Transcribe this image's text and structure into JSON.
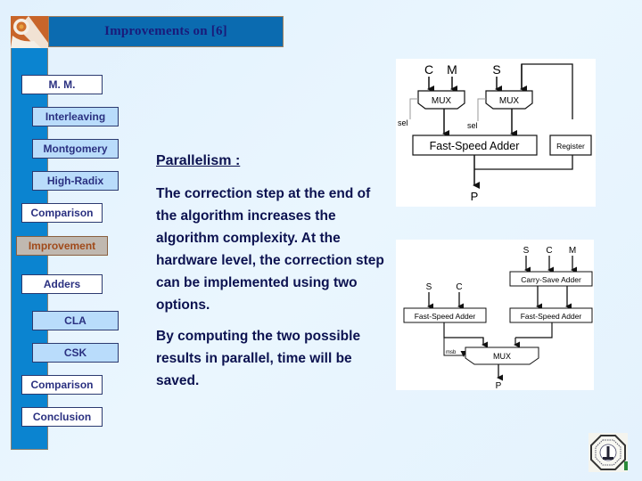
{
  "header": {
    "title": "Improvements on [6]"
  },
  "sidebar": {
    "items": [
      {
        "label": "M. M.",
        "level": "main",
        "active": false
      },
      {
        "label": "Interleaving",
        "level": "sub",
        "active": false
      },
      {
        "label": "Montgomery",
        "level": "sub",
        "active": false
      },
      {
        "label": "High-Radix",
        "level": "sub",
        "active": false
      },
      {
        "label": "Comparison",
        "level": "main",
        "active": false
      },
      {
        "label": "Improvement",
        "level": "main",
        "active": true
      },
      {
        "label": "Adders",
        "level": "main",
        "active": false
      },
      {
        "label": "CLA",
        "level": "sub",
        "active": false
      },
      {
        "label": "CSK",
        "level": "sub",
        "active": false
      },
      {
        "label": "Comparison",
        "level": "main",
        "active": false
      },
      {
        "label": "Conclusion",
        "level": "main",
        "active": false
      }
    ]
  },
  "content": {
    "heading": "Parallelism :",
    "paragraph1": "The correction step at the end of the algorithm increases the algorithm complexity. At the hardware level, the correction step can be implemented using two options.",
    "paragraph2": "By computing the two possible results in parallel, time will be saved."
  },
  "diagram1": {
    "inputs": [
      "C",
      "M",
      "S"
    ],
    "mux1": "MUX",
    "mux2": "MUX",
    "sel1": "sel",
    "sel2": "sel",
    "adder": "Fast-Speed Adder",
    "register": "Register",
    "output": "P"
  },
  "diagram2": {
    "left_inputs": [
      "S",
      "C"
    ],
    "right_inputs": [
      "S",
      "C",
      "M"
    ],
    "csa": "Carry-Save Adder",
    "adder_left": "Fast-Speed Adder",
    "adder_right": "Fast-Speed Adder",
    "mux": "MUX",
    "msb": "msb",
    "output": "P"
  },
  "colors": {
    "title_bar": "#0b6bb0",
    "side_bar": "#0b84d0",
    "nav_sub": "#b9dcfb",
    "nav_active_bg": "#c0b8b0",
    "nav_active_text": "#a04a1a",
    "text": "#0c1250"
  }
}
